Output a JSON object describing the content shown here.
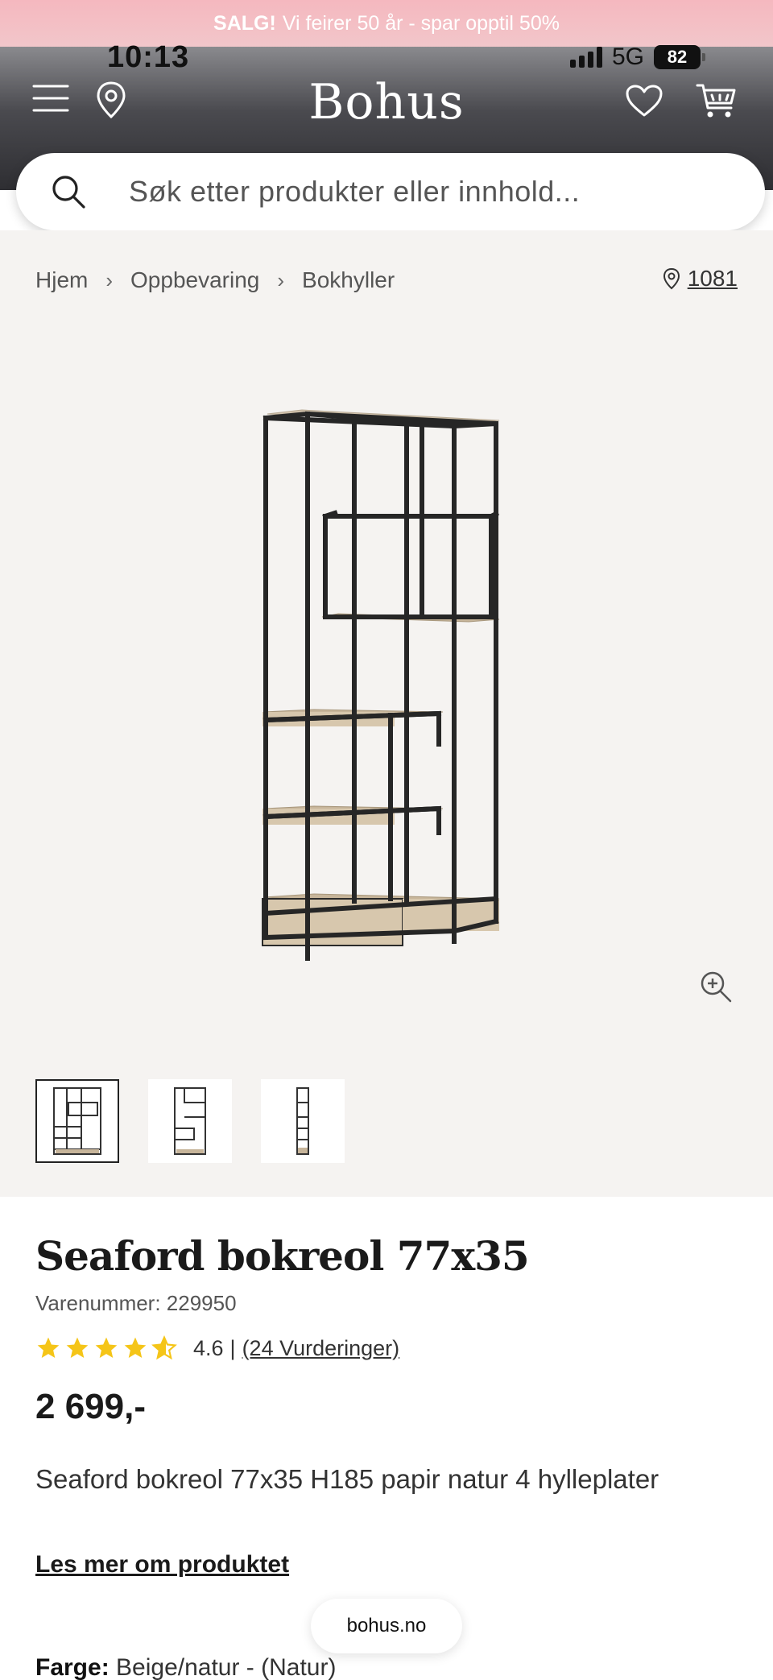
{
  "promo": {
    "bold": "SALG!",
    "text": "Vi feirer 50 år - spar opptil 50%"
  },
  "status": {
    "time": "10:13",
    "network": "5G",
    "battery": "82"
  },
  "header": {
    "logo": "Bohus",
    "icons": [
      "menu-icon",
      "location-pin-icon",
      "heart-icon",
      "cart-icon"
    ]
  },
  "search": {
    "placeholder": "Søk etter produkter eller innhold..."
  },
  "breadcrumb": {
    "items": [
      "Hjem",
      "Oppbevaring",
      "Bokhyller"
    ],
    "separator": "›"
  },
  "store": {
    "number": "1081"
  },
  "gallery": {
    "thumbnail_count": 3,
    "active_index": 0
  },
  "product": {
    "title": "Seaford bokreol 77x35",
    "sku": "Varenummer: 229950",
    "rating_value": "4.6",
    "rating_divider": "|",
    "rating_count": "(24 Vurderinger)",
    "stars": 4.6,
    "price": "2 699,-",
    "description": "Seaford bokreol 77x35 H185 papir natur 4 hylleplater",
    "read_more": "Les mer om produktet",
    "color_label": "Farge:",
    "color_value": "Beige/natur - (Natur)"
  },
  "site_pill": "bohus.no",
  "colors": {
    "promo": "#f5b8bf",
    "header_dark": "#2e2e32",
    "gallery_bg": "#f5f3f1",
    "star": "#f5c518"
  }
}
